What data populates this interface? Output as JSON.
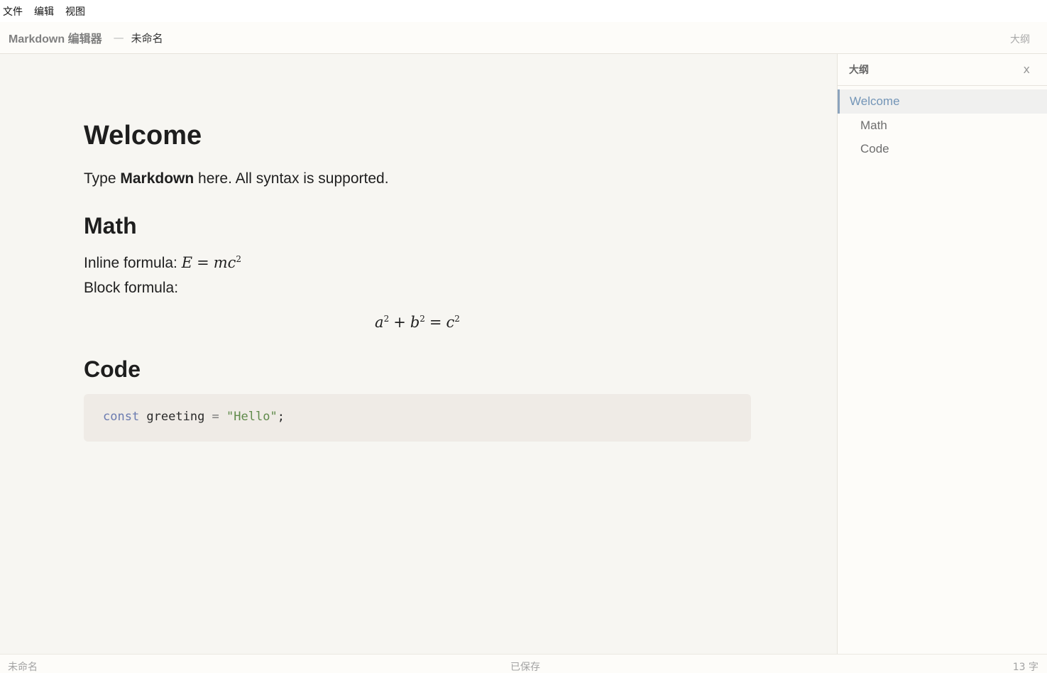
{
  "menubar": {
    "items": [
      "文件",
      "编辑",
      "视图"
    ]
  },
  "titlebar": {
    "app_name": "Markdown 编辑器",
    "separator": "—",
    "doc_name": "未命名",
    "outline_toggle": "大纲"
  },
  "document": {
    "h1": "Welcome",
    "intro_pre": "Type ",
    "intro_bold": "Markdown",
    "intro_post": " here. All syntax is supported.",
    "math_heading": "Math",
    "inline_label": "Inline formula: ",
    "inline_formula": {
      "lhs": "E",
      "op": "=",
      "rhs": "mc",
      "exp": "2"
    },
    "block_label": "Block formula:",
    "block_formula": {
      "a": "a",
      "b": "b",
      "c": "c",
      "exp": "2",
      "plus": "+",
      "eq": "="
    },
    "code_heading": "Code",
    "code": {
      "keyword": "const",
      "name": " greeting ",
      "op": "=",
      "string": " \"Hello\"",
      "end": ";"
    }
  },
  "outline": {
    "title": "大纲",
    "close_label": "x",
    "items": [
      {
        "label": "Welcome",
        "level": 1,
        "active": true
      },
      {
        "label": "Math",
        "level": 2,
        "active": false
      },
      {
        "label": "Code",
        "level": 2,
        "active": false
      }
    ]
  },
  "statusbar": {
    "filename": "未命名",
    "save_status": "已保存",
    "word_count": "13 字"
  }
}
